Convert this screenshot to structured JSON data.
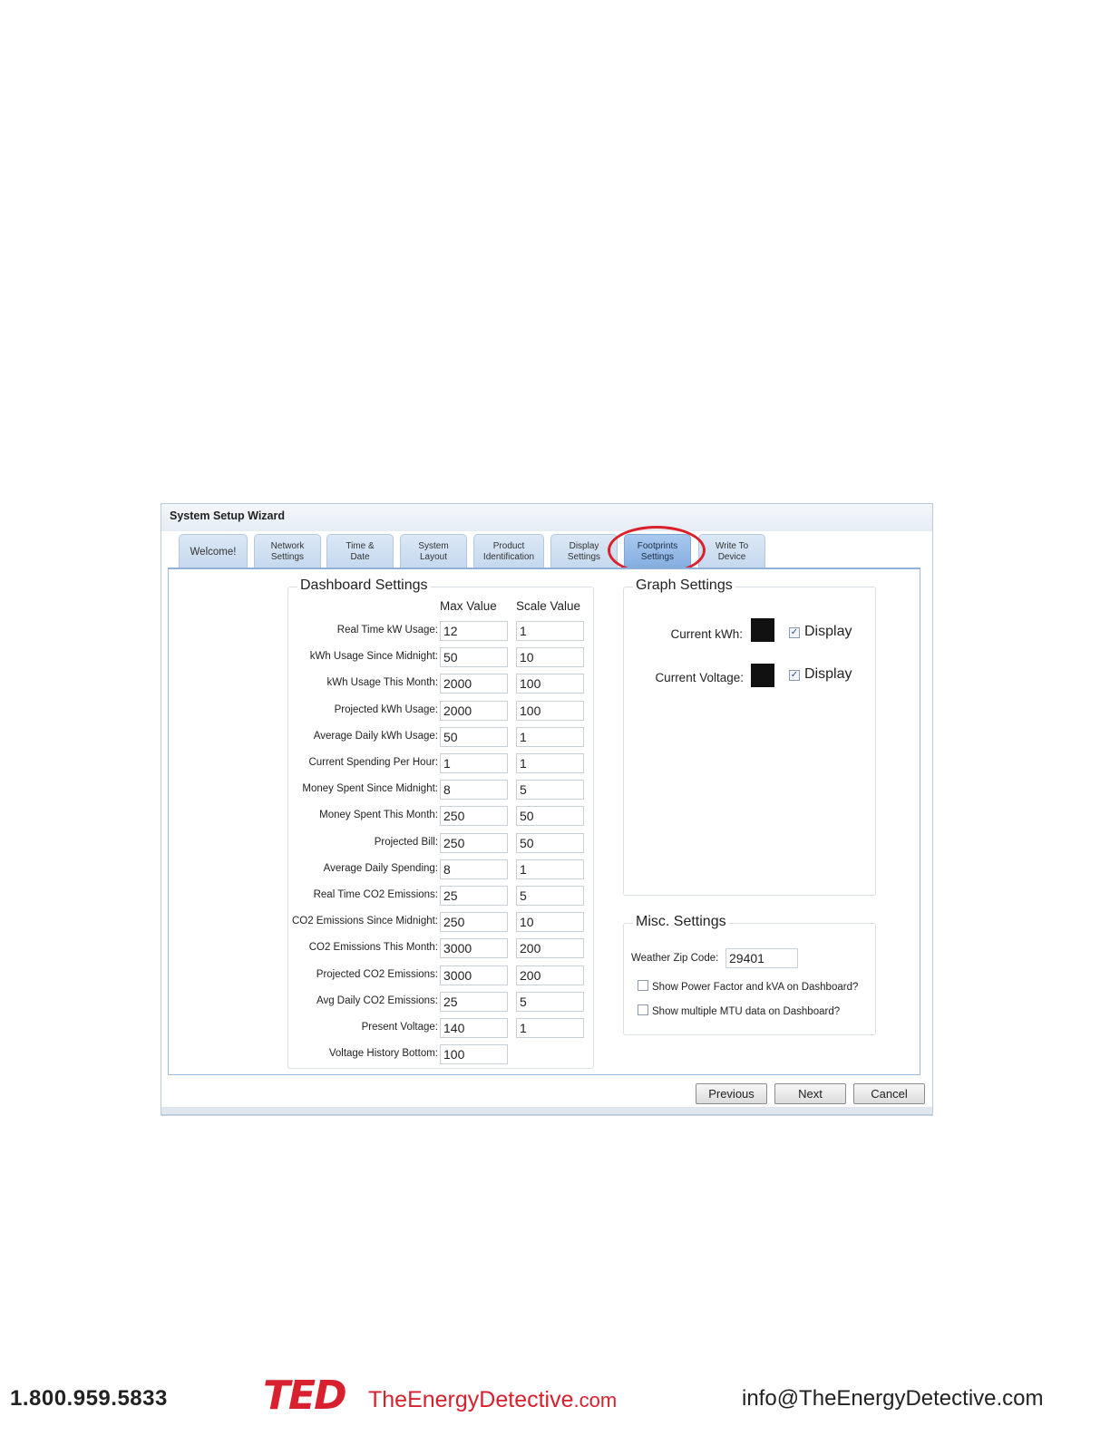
{
  "window": {
    "title": "System Setup Wizard"
  },
  "tabs": [
    {
      "label": "Welcome!"
    },
    {
      "line1": "Network",
      "line2": "Settings"
    },
    {
      "line1": "Time &",
      "line2": "Date"
    },
    {
      "line1": "System",
      "line2": "Layout"
    },
    {
      "line1": "Product",
      "line2": "Identification"
    },
    {
      "line1": "Display",
      "line2": "Settings"
    },
    {
      "line1": "Footprints",
      "line2": "Settings"
    },
    {
      "line1": "Write To",
      "line2": "Device"
    }
  ],
  "active_tab": "Footprints Settings",
  "dashboard": {
    "title": "Dashboard Settings",
    "col_max": "Max Value",
    "col_scale": "Scale Value",
    "rows": [
      {
        "label": "Real Time kW Usage:",
        "max": "12",
        "scale": "1"
      },
      {
        "label": "kWh Usage Since Midnight:",
        "max": "50",
        "scale": "10"
      },
      {
        "label": "kWh Usage This Month:",
        "max": "2000",
        "scale": "100"
      },
      {
        "label": "Projected kWh Usage:",
        "max": "2000",
        "scale": "100"
      },
      {
        "label": "Average Daily kWh Usage:",
        "max": "50",
        "scale": "1"
      },
      {
        "label": "Current Spending Per Hour:",
        "max": "1",
        "scale": "1"
      },
      {
        "label": "Money Spent Since Midnight:",
        "max": "8",
        "scale": "5"
      },
      {
        "label": "Money Spent This Month:",
        "max": "250",
        "scale": "50"
      },
      {
        "label": "Projected Bill:",
        "max": "250",
        "scale": "50"
      },
      {
        "label": "Average Daily Spending:",
        "max": "8",
        "scale": "1"
      },
      {
        "label": "Real Time CO2 Emissions:",
        "max": "25",
        "scale": "5"
      },
      {
        "label": "CO2 Emissions Since Midnight:",
        "max": "250",
        "scale": "10"
      },
      {
        "label": "CO2 Emissions This Month:",
        "max": "3000",
        "scale": "200"
      },
      {
        "label": "Projected CO2 Emissions:",
        "max": "3000",
        "scale": "200"
      },
      {
        "label": "Avg Daily CO2 Emissions:",
        "max": "25",
        "scale": "5"
      },
      {
        "label": "Present Voltage:",
        "max": "140",
        "scale": "1"
      },
      {
        "label": "Voltage History Bottom:",
        "max": "100",
        "scale": null
      }
    ]
  },
  "graph": {
    "title": "Graph Settings",
    "kwh_label": "Current kWh:",
    "voltage_label": "Current Voltage:",
    "display_label": "Display",
    "kwh_color": "#111111",
    "voltage_color": "#111111",
    "kwh_display_checked": true,
    "voltage_display_checked": true
  },
  "misc": {
    "title": "Misc. Settings",
    "zip_label": "Weather Zip Code:",
    "zip_value": "29401",
    "power_factor_label": "Show Power Factor and kVA on Dashboard?",
    "power_factor_checked": false,
    "mtu_label": "Show multiple MTU data on Dashboard?",
    "mtu_checked": false
  },
  "buttons": {
    "previous": "Previous",
    "next": "Next",
    "cancel": "Cancel"
  },
  "footer": {
    "phone": "1.800.959.5833",
    "logo": "TED",
    "site_main": "TheEnergyDetective",
    "site_tld": ".com",
    "email": "info@TheEnergyDetective.com"
  },
  "colors": {
    "brand_red": "#d8202e",
    "highlight_ring": "#d9202b",
    "active_tab": "#84addf"
  }
}
